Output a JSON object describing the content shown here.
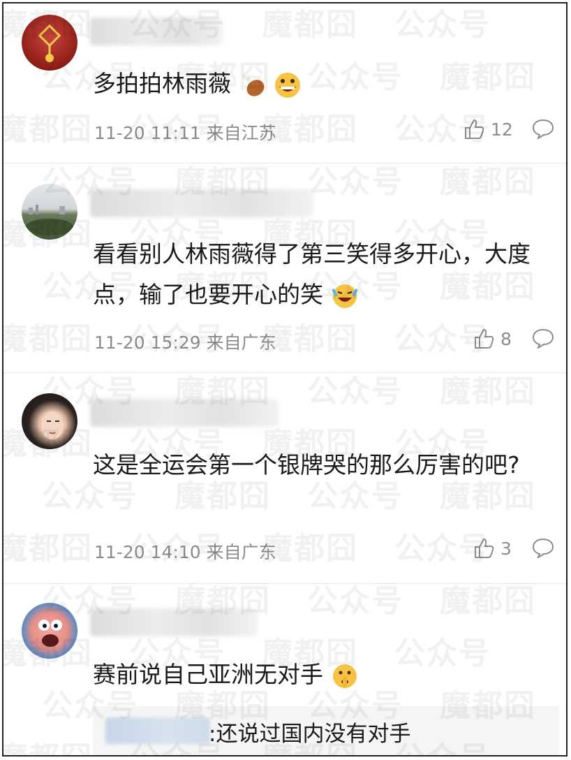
{
  "watermark_text": "魔都囧  公众号",
  "comments": [
    {
      "text": "多拍拍林雨薇",
      "emojis": [
        "chicken-leg-emoji",
        "grin-emoji"
      ],
      "meta": "11-20 11:11 来自江苏",
      "likes": "12"
    },
    {
      "text": "看看别人林雨薇得了第三笑得多开心，大度点，输了也要开心的笑",
      "emojis": [
        "laugh-tears-emoji"
      ],
      "meta": "11-20 15:29 来自广东",
      "likes": "8"
    },
    {
      "text": "这是全运会第一个银牌哭的那么厉害的吧?",
      "emojis": [],
      "meta": "11-20 14:10 来自广东",
      "likes": "3"
    },
    {
      "text": "赛前说自己亚洲无对手",
      "emojis": [
        "shush-emoji"
      ],
      "reply_text": ":还说过国内没有对手"
    }
  ]
}
